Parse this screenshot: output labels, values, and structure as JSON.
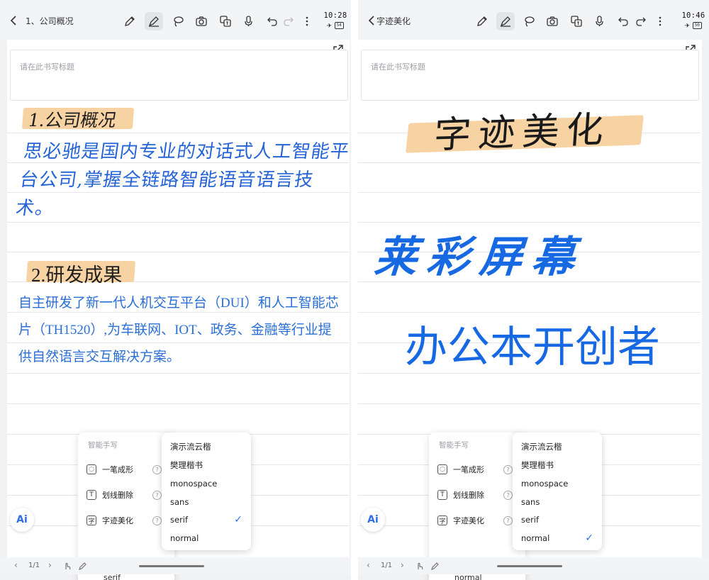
{
  "left": {
    "toolbar": {
      "title": "1、公司概况"
    },
    "status": {
      "time": "10:28",
      "battery": "54"
    },
    "page": {
      "title_placeholder": "请在此书写标题",
      "heading1": "1.公司概况",
      "paragraph1": "思必驰是国内专业的对话式人工智能平台公司,掌握全链路智能语音语言技术。",
      "heading2": "2.研发成果",
      "paragraph2": "自主研发了新一代人机交互平台（DUI）和人工智能芯片（TH1520）,为车联网、IOT、政务、金融等行业提供自然语言交互解决方案。"
    },
    "smart_menu": {
      "header": "智能手写",
      "items": [
        {
          "label": "一笔成形"
        },
        {
          "label": "划线删除"
        },
        {
          "label": "字迹美化"
        }
      ],
      "current_font": "serif"
    },
    "font_menu": {
      "options": [
        {
          "label": "演示流云楷"
        },
        {
          "label": "樊理楷书"
        },
        {
          "label": "monospace"
        },
        {
          "label": "sans"
        },
        {
          "label": "serif"
        },
        {
          "label": "normal"
        }
      ],
      "selected": "serif"
    },
    "bottom": {
      "pager": "1/1"
    }
  },
  "right": {
    "toolbar": {
      "title": "字迹美化"
    },
    "status": {
      "time": "10:46",
      "battery": "50"
    },
    "page": {
      "title_placeholder": "请在此书写标题",
      "line1": "字迹美化",
      "line2": "莱彩屏幕",
      "line3": "办公本开创者"
    },
    "smart_menu": {
      "header": "智能手写",
      "items": [
        {
          "label": "一笔成形"
        },
        {
          "label": "划线删除"
        },
        {
          "label": "字迹美化"
        }
      ],
      "current_font": "normal"
    },
    "font_menu": {
      "options": [
        {
          "label": "演示流云楷"
        },
        {
          "label": "樊理楷书"
        },
        {
          "label": "monospace"
        },
        {
          "label": "sans"
        },
        {
          "label": "serif"
        },
        {
          "label": "normal"
        }
      ],
      "selected": "normal"
    },
    "bottom": {
      "pager": "1/1"
    }
  },
  "ai_label": "Ai",
  "colors": {
    "ink_blue": "#2564d6",
    "highlight": "#f7d3a3",
    "accent": "#2c6ee8"
  }
}
